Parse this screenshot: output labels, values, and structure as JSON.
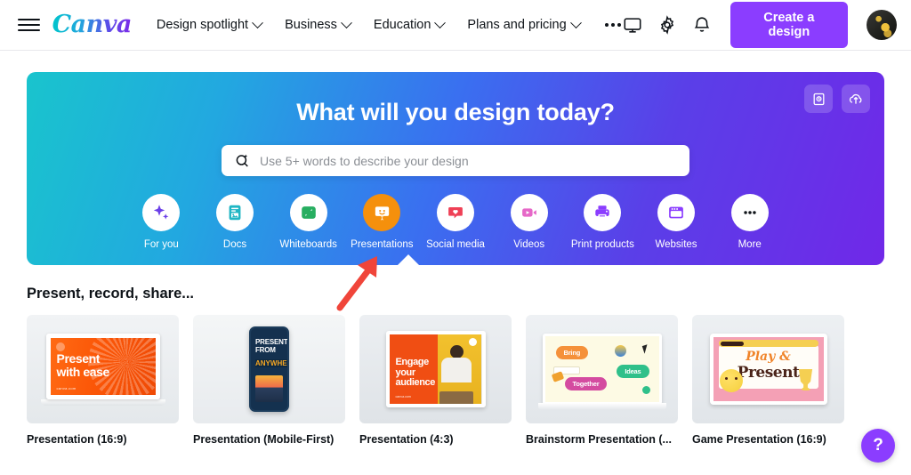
{
  "header": {
    "menu_icon": "hamburger-icon",
    "logo_text": "Canva",
    "nav": [
      {
        "label": "Design spotlight",
        "has_chevron": true
      },
      {
        "label": "Business",
        "has_chevron": true
      },
      {
        "label": "Education",
        "has_chevron": true
      },
      {
        "label": "Plans and pricing",
        "has_chevron": true
      }
    ],
    "overflow_icon": "more-horizontal-icon",
    "icons": [
      {
        "name": "monitor-icon"
      },
      {
        "name": "gear-icon"
      },
      {
        "name": "bell-icon"
      }
    ],
    "create_button": "Create a design",
    "avatar": "user-avatar",
    "accent_purple": "#8b3dff"
  },
  "hero": {
    "title": "What will you design today?",
    "gradient_start": "#19c4cd",
    "gradient_mid": "#3a6ff0",
    "gradient_end": "#7028e8",
    "search": {
      "placeholder": "Use 5+ words to describe your design",
      "icon": "magic-search-icon"
    },
    "corner_icons": [
      {
        "name": "design-template-icon"
      },
      {
        "name": "cloud-upload-icon"
      }
    ],
    "categories": [
      {
        "label": "For you",
        "icon": "sparkle-icon",
        "selected": false
      },
      {
        "label": "Docs",
        "icon": "document-icon",
        "selected": false
      },
      {
        "label": "Whiteboards",
        "icon": "whiteboard-icon",
        "selected": false
      },
      {
        "label": "Presentations",
        "icon": "presentation-icon",
        "selected": true
      },
      {
        "label": "Social media",
        "icon": "heart-chat-icon",
        "selected": false
      },
      {
        "label": "Videos",
        "icon": "video-camera-icon",
        "selected": false
      },
      {
        "label": "Print products",
        "icon": "printer-icon",
        "selected": false
      },
      {
        "label": "Websites",
        "icon": "browser-window-icon",
        "selected": false
      },
      {
        "label": "More",
        "icon": "more-dots-icon",
        "selected": false
      }
    ],
    "selected_highlight_color": "#f5900c"
  },
  "annotation": {
    "arrow_color": "#f0453a",
    "points_to": "Presentations"
  },
  "section": {
    "title": "Present, record, share...",
    "cards": [
      {
        "label": "Presentation (16:9)",
        "thumb": "laptop-present-with-ease",
        "thumb_text": [
          "Present",
          "with ease"
        ]
      },
      {
        "label": "Presentation (Mobile-First)",
        "thumb": "phone-present-from-anywhere",
        "thumb_text": [
          "PRESENT",
          "FROM",
          "ANYWHERE"
        ]
      },
      {
        "label": "Presentation (4:3)",
        "thumb": "slide-engage-your-audience",
        "thumb_text": [
          "Engage",
          "your",
          "audience"
        ]
      },
      {
        "label": "Brainstorm Presentation (...",
        "thumb": "whiteboard-brainstorm",
        "thumb_text": [
          "Bring",
          "Ideas",
          "Together"
        ]
      },
      {
        "label": "Game Presentation (16:9)",
        "thumb": "game-play-and-present",
        "thumb_text": [
          "Play &",
          "Present"
        ]
      }
    ]
  },
  "help": {
    "label": "?"
  }
}
